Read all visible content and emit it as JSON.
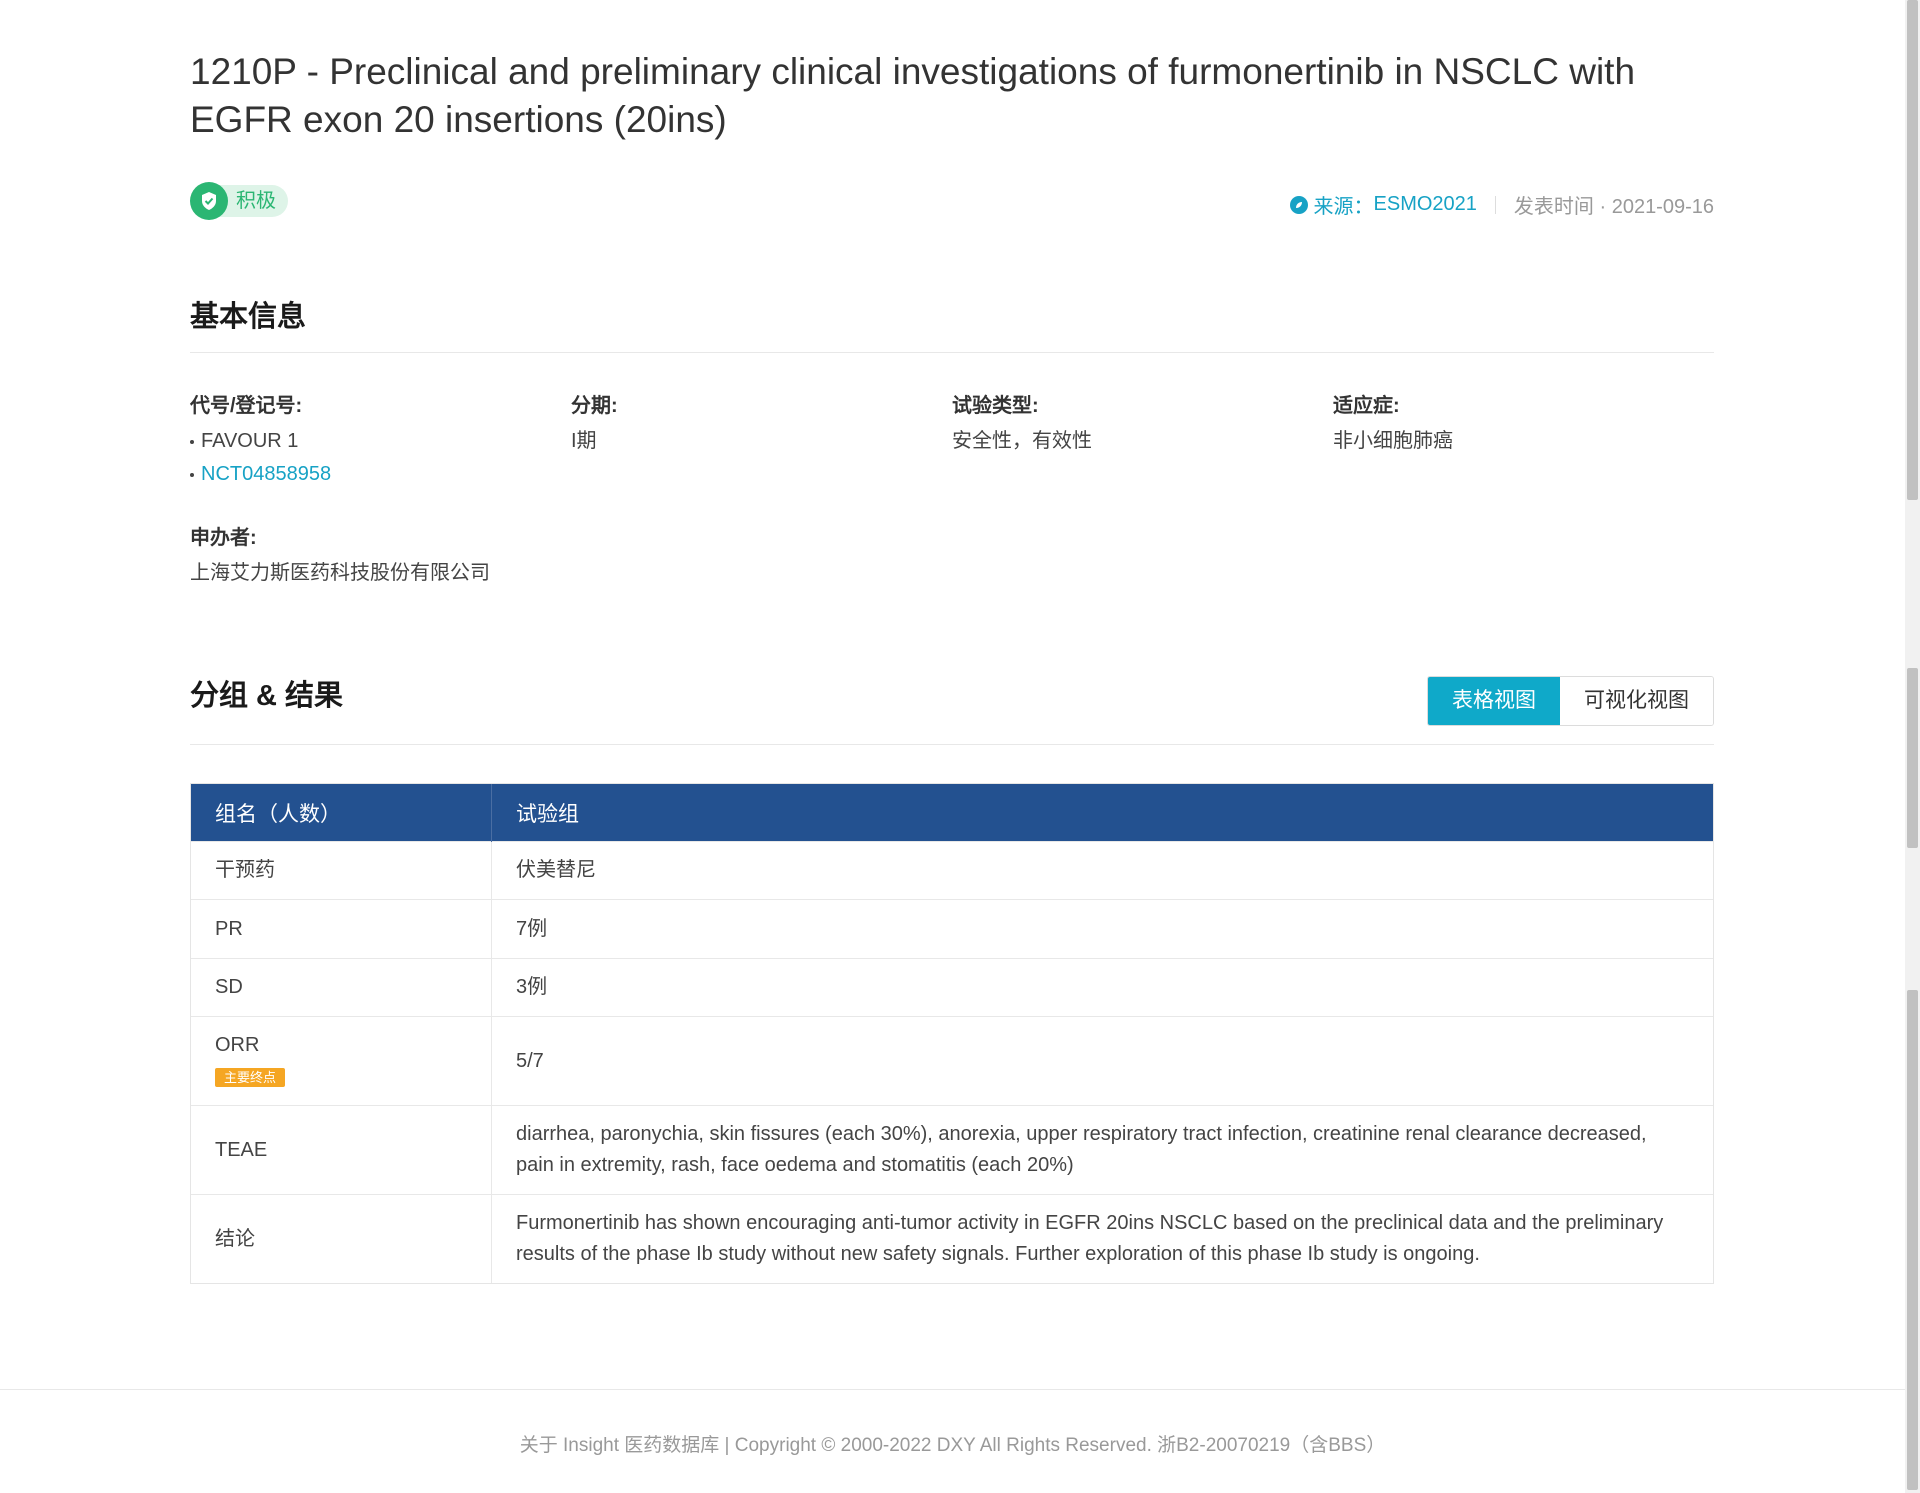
{
  "article": {
    "title": "1210P - Preclinical and preliminary clinical investigations of furmonertinib in NSCLC with EGFR exon 20 insertions (20ins)",
    "sentiment_label": "积极",
    "source_label": "来源：",
    "source_value": "ESMO2021",
    "published_label": "发表时间 · 2021-09-16",
    "colors": {
      "accent": "#17a2c5",
      "positive": "#2bb673",
      "table_header": "#235190",
      "tag": "#f5a623"
    }
  },
  "basic": {
    "title": "基本信息",
    "code_label": "代号/登记号:",
    "codes": [
      "FAVOUR 1",
      "NCT04858958"
    ],
    "phase_label": "分期:",
    "phase_value": "I期",
    "trial_type_label": "试验类型:",
    "trial_type_value": "安全性，有效性",
    "indication_label": "适应症:",
    "indication_value": "非小细胞肺癌",
    "sponsor_label": "申办者:",
    "sponsor_value": "上海艾力斯医药科技股份有限公司"
  },
  "results": {
    "title": "分组 & 结果",
    "view_table": "表格视图",
    "view_visual": "可视化视图",
    "col_group": "组名（人数）",
    "col_arm": "试验组",
    "rows": [
      {
        "label": "干预药",
        "value": "伏美替尼"
      },
      {
        "label": "PR",
        "value": "7例"
      },
      {
        "label": "SD",
        "value": "3例"
      },
      {
        "label": "ORR",
        "tag": "主要终点",
        "value": "5/7"
      },
      {
        "label": "TEAE",
        "value": "diarrhea, paronychia, skin fissures (each 30%), anorexia, upper respiratory tract infection, creatinine renal clearance decreased, pain in extremity, rash, face oedema and stomatitis (each 20%)"
      },
      {
        "label": "结论",
        "value": "Furmonertinib has shown encouraging anti-tumor activity in EGFR 20ins NSCLC based on the preclinical data and the preliminary results of the phase Ib study without new safety signals. Further exploration of this phase Ib study is ongoing."
      }
    ]
  },
  "footer": {
    "text": "关于 Insight 医药数据库 | Copyright © 2000-2022 DXY All Rights Reserved. 浙B2-20070219（含BBS）"
  }
}
